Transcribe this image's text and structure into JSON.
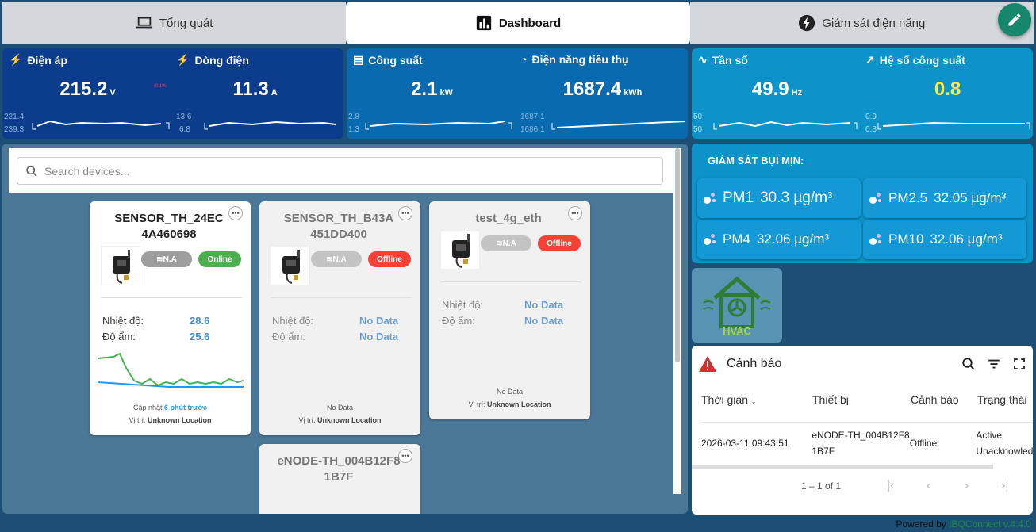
{
  "tabs": [
    {
      "label": "Tổng quát",
      "icon": "laptop-icon"
    },
    {
      "label": "Dashboard",
      "icon": "bar-chart-icon"
    },
    {
      "label": "Giám sát điện năng",
      "icon": "bolt-circle-icon"
    }
  ],
  "active_tab": "Dashboard",
  "metrics": {
    "dien_ap": {
      "title": "Điện áp",
      "value": "215.2",
      "unit": "V",
      "tiny": "↑0.1%",
      "max": "221.4",
      "min": "239.3"
    },
    "dong_dien": {
      "title": "Dòng điện",
      "value": "11.3",
      "unit": "A",
      "max": "13.6",
      "min": "6.8"
    },
    "cong_suat": {
      "title": "Công suất",
      "value": "2.1",
      "unit": "kW",
      "max": "2.8",
      "min": "1.3"
    },
    "dien_nang": {
      "title": "Điện năng tiêu thụ",
      "value": "1687.4",
      "unit": "kWh",
      "max": "1687.1",
      "min": "1686.1"
    },
    "tan_so": {
      "title": "Tần số",
      "value": "49.9",
      "unit": "Hz",
      "max": "50",
      "min": "50"
    },
    "he_so": {
      "title": "Hệ số công suất",
      "value": "0.8",
      "max": "0.9",
      "min": "0.8"
    }
  },
  "search": {
    "placeholder": "Search devices..."
  },
  "devices": [
    {
      "name": "SENSOR_TH_24EC 4A460698",
      "signal": "N.A",
      "status": "Online",
      "temp_label": "Nhiệt độ:",
      "temp": "28.6",
      "hum_label": "Độ ẩm:",
      "hum": "25.6",
      "updated_label": "Cập nhật:",
      "updated": "6 phút trước",
      "location_label": "Vị trí:",
      "location": "Unknown Location"
    },
    {
      "name": "SENSOR_TH_B43A 451DD400",
      "signal": "N.A",
      "status": "Offline",
      "temp_label": "Nhiệt độ:",
      "temp": "No Data",
      "hum_label": "Độ ẩm:",
      "hum": "No Data",
      "nodata": "No Data",
      "location_label": "Vị trí:",
      "location": "Unknown Location"
    },
    {
      "name": "test_4g_eth",
      "signal": "N.A",
      "status": "Offline",
      "temp_label": "Nhiệt độ:",
      "temp": "No Data",
      "hum_label": "Độ ẩm:",
      "hum": "No Data",
      "nodata": "No Data",
      "location_label": "Vị trí:",
      "location": "Unknown Location"
    },
    {
      "name": "eNODE-TH_004B12F81B7F"
    }
  ],
  "pm": {
    "title": "GIÁM SÁT BỤI MỊN:",
    "items": [
      {
        "label": "PM1",
        "value": "30.3 µg/m³"
      },
      {
        "label": "PM2.5",
        "value": "32.05 µg/m³"
      },
      {
        "label": "PM4",
        "value": "32.06 µg/m³"
      },
      {
        "label": "PM10",
        "value": "32.06 µg/m³"
      }
    ]
  },
  "hvac": {
    "label": "HVAC"
  },
  "alerts": {
    "title": "Cảnh báo",
    "columns": [
      "Thời gian",
      "Thiết bị",
      "Cảnh báo",
      "Trạng thái"
    ],
    "rows": [
      {
        "time": "2026-03-11 09:43:51",
        "device": "eNODE-TH_004B12F81B7F",
        "alert": "Offline",
        "state": "Active Unacknowledged"
      }
    ],
    "pagination": "1 – 1 of 1"
  },
  "footer": {
    "powered": "Powered by",
    "brand": "IBQConnect v.4.4.0"
  },
  "colors": {
    "online": "#4caf50",
    "offline": "#f44336",
    "accent": "#0d92c9",
    "highlight": "#ffeb3b"
  }
}
